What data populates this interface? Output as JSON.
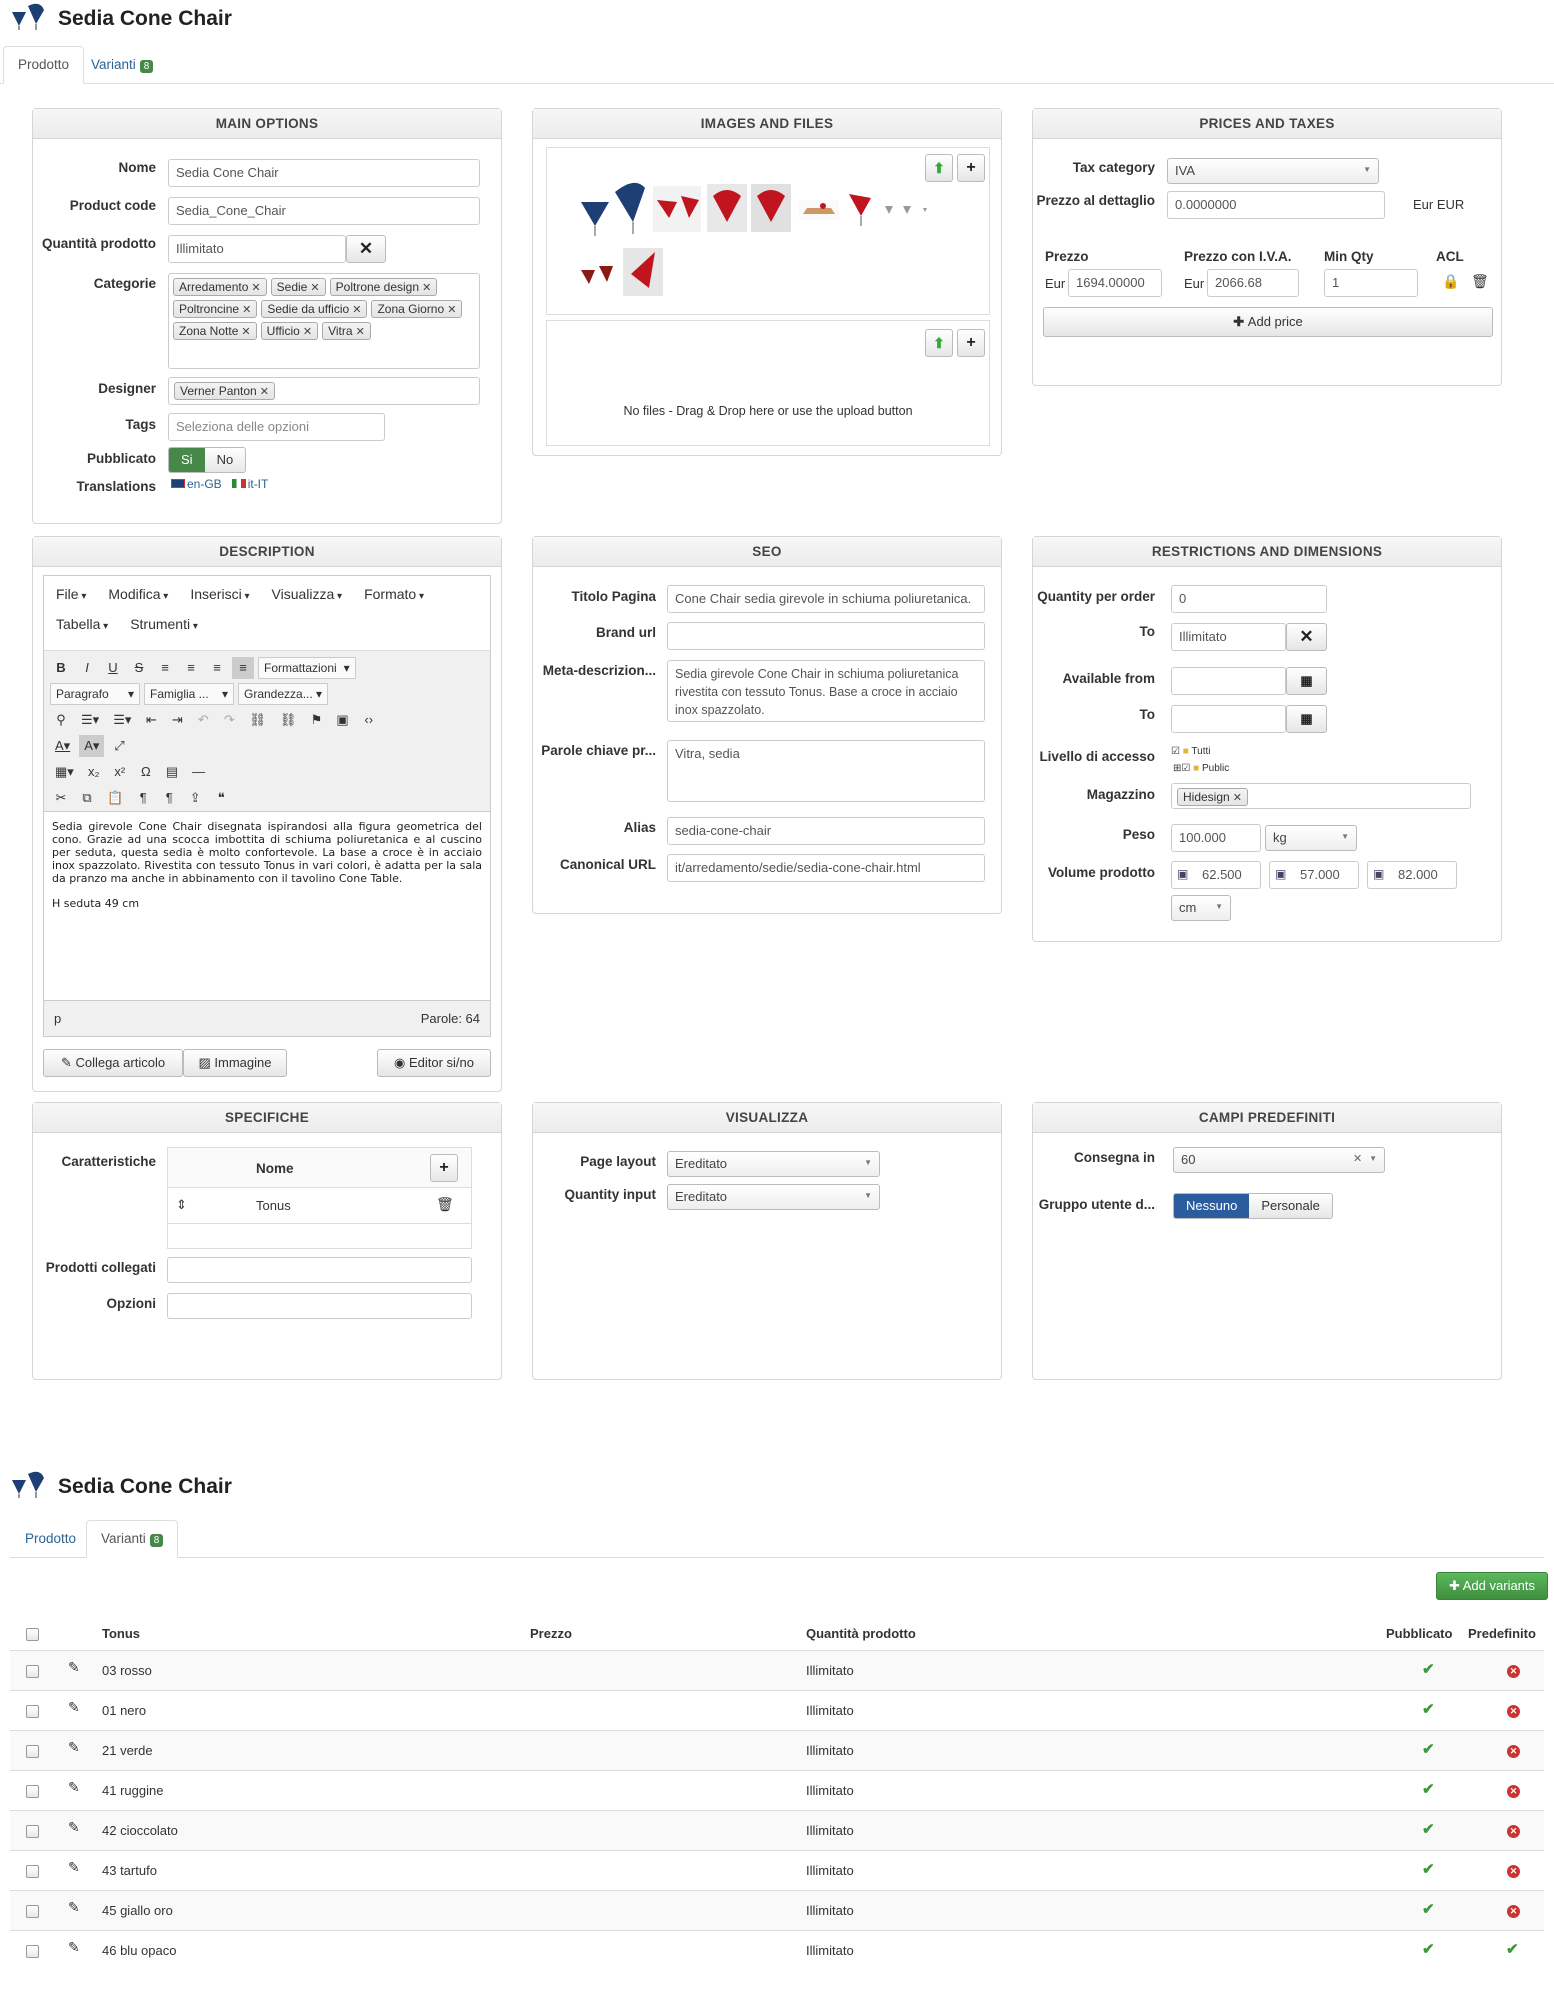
{
  "top": {
    "title": "Sedia Cone Chair",
    "tab_product": "Prodotto",
    "tab_variants": "Varianti",
    "variants_count": "8"
  },
  "main_options": {
    "heading": "MAIN OPTIONS",
    "name_label": "Nome",
    "name_value": "Sedia Cone Chair",
    "code_label": "Product code",
    "code_value": "Sedia_Cone_Chair",
    "qty_label": "Quantità prodotto",
    "qty_value": "Illimitato",
    "categories_label": "Categorie",
    "categories": [
      "Arredamento",
      "Sedie",
      "Poltrone design",
      "Poltroncine",
      "Sedie da ufficio",
      "Zona Giorno",
      "Zona Notte",
      "Ufficio",
      "Vitra"
    ],
    "designer_label": "Designer",
    "designer": "Verner Panton",
    "tags_label": "Tags",
    "tags_placeholder": "Seleziona delle opzioni",
    "published_label": "Pubblicato",
    "yes": "Si",
    "no": "No",
    "translations_label": "Translations",
    "trans_en": "en-GB",
    "trans_it": "it-IT"
  },
  "images": {
    "heading": "IMAGES AND FILES",
    "no_files": "No files - Drag & Drop here or use the upload button"
  },
  "prices": {
    "heading": "PRICES AND TAXES",
    "tax_label": "Tax category",
    "tax_value": "IVA",
    "retail_label": "Prezzo al dettaglio",
    "retail_value": "0.0000000",
    "retail_currency": "Eur EUR",
    "col_price": "Prezzo",
    "col_price_vat": "Prezzo con I.V.A.",
    "col_min_qty": "Min Qty",
    "col_acl": "ACL",
    "cur1": "Eur",
    "price": "1694.00000",
    "cur2": "Eur",
    "price_vat": "2066.68",
    "min_qty": "1",
    "add_price": "Add price"
  },
  "description": {
    "heading": "DESCRIPTION",
    "menus": [
      "File",
      "Modifica",
      "Inserisci",
      "Visualizza",
      "Formato",
      "Tabella",
      "Strumenti"
    ],
    "formats": "Formattazioni",
    "paragraph": "Paragrafo",
    "family": "Famiglia ...",
    "size": "Grandezza...",
    "text": "Sedia girevole Cone Chair disegnata ispirandosi alla figura geometrica del cono. Grazie ad una scocca imbottita di schiuma poliuretanica e al cuscino per seduta, questa sedia è molto confortevole. La base a croce è in acciaio inox spazzolato. Rivestita con tessuto Tonus in vari colori, è adatta per la sala da pranzo ma anche in abbinamento con il tavolino Cone Table.",
    "text2": "H seduta 49 cm",
    "path": "p",
    "words": "Parole: 64",
    "btn_link": "Collega articolo",
    "btn_image": "Immagine",
    "btn_editor": "Editor si/no"
  },
  "seo": {
    "heading": "SEO",
    "title_label": "Titolo Pagina",
    "title_value": "Cone Chair sedia girevole in schiuma poliuretanica.",
    "brand_label": "Brand url",
    "meta_label": "Meta-descrizion...",
    "meta_value": "Sedia girevole Cone Chair in schiuma poliuretanica rivestita con tessuto Tonus. Base a croce in acciaio inox spazzolato.",
    "keywords_label": "Parole chiave pr...",
    "keywords_value": "Vitra, sedia",
    "alias_label": "Alias",
    "alias_value": "sedia-cone-chair",
    "canonical_label": "Canonical URL",
    "canonical_value": "it/arredamento/sedie/sedia-cone-chair.html"
  },
  "restrictions": {
    "heading": "RESTRICTIONS AND DIMENSIONS",
    "qpo_label": "Quantity per order",
    "qpo_value": "0",
    "to_label": "To",
    "to_value": "Illimitato",
    "avail_label": "Available from",
    "to2_label": "To",
    "access_label": "Livello di accesso",
    "access_all": "Tutti",
    "access_public": "Public",
    "warehouse_label": "Magazzino",
    "warehouse": "Hidesign",
    "weight_label": "Peso",
    "weight_value": "100.000",
    "weight_unit": "kg",
    "volume_label": "Volume prodotto",
    "dim1": "62.500",
    "dim2": "57.000",
    "dim3": "82.000",
    "dim_unit": "cm"
  },
  "specs": {
    "heading": "SPECIFICHE",
    "feat_label": "Caratteristiche",
    "col_name": "Nome",
    "row_name": "Tonus",
    "related_label": "Prodotti collegati",
    "options_label": "Opzioni"
  },
  "display": {
    "heading": "VISUALIZZA",
    "layout_label": "Page layout",
    "layout_value": "Ereditato",
    "qinput_label": "Quantity input",
    "qinput_value": "Ereditato"
  },
  "fields": {
    "heading": "CAMPI PREDEFINITI",
    "delivery_label": "Consegna in",
    "delivery_value": "60",
    "group_label": "Gruppo utente d...",
    "none": "Nessuno",
    "personal": "Personale"
  },
  "variants": {
    "title": "Sedia Cone Chair",
    "tab_product": "Prodotto",
    "tab_variants": "Varianti",
    "count": "8",
    "add_btn": "Add variants",
    "col_tonus": "Tonus",
    "col_price": "Prezzo",
    "col_qty": "Quantità prodotto",
    "col_pub": "Pubblicato",
    "col_def": "Predefinito",
    "rows": [
      {
        "name": "03 rosso",
        "qty": "Illimitato"
      },
      {
        "name": "01 nero",
        "qty": "Illimitato"
      },
      {
        "name": "21 verde",
        "qty": "Illimitato"
      },
      {
        "name": "41 ruggine",
        "qty": "Illimitato"
      },
      {
        "name": "42 cioccolato",
        "qty": "Illimitato"
      },
      {
        "name": "43 tartufo",
        "qty": "Illimitato"
      },
      {
        "name": "45 giallo oro",
        "qty": "Illimitato"
      },
      {
        "name": "46 blu opaco",
        "qty": "Illimitato"
      }
    ]
  }
}
